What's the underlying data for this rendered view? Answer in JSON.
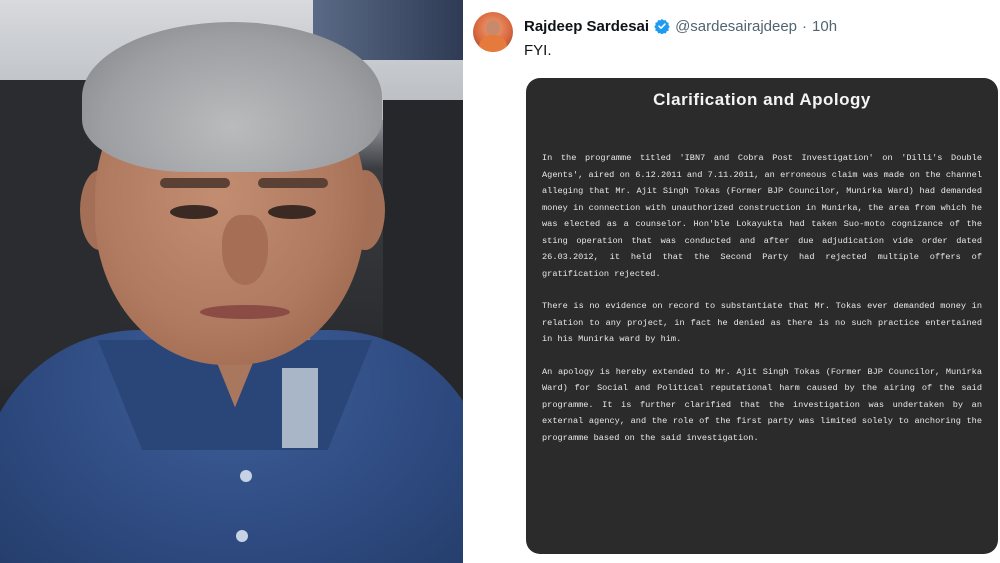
{
  "tweet": {
    "display_name": "Rajdeep Sardesai",
    "handle": "@sardesairajdeep",
    "separator": "·",
    "time": "10h",
    "text": "FYI.",
    "verified_color": "#1d9bf0"
  },
  "notice": {
    "title": "Clarification and Apology",
    "paragraphs": [
      "In the programme titled 'IBN7 and Cobra Post Investigation' on 'Dilli's Double Agents', aired on 6.12.2011 and 7.11.2011, an erroneous claim was made on the channel alleging that Mr. Ajit Singh Tokas (Former BJP Councilor, Munirka Ward) had demanded money in connection with unauthorized construction in Munirka, the area from which he was elected as a counselor. Hon'ble Lokayukta had taken Suo-moto cognizance of the sting operation that was conducted and after due adjudication vide order dated 26.03.2012, it held that the Second Party had rejected multiple offers of gratification rejected.",
      "There is no evidence on record to substantiate that Mr. Tokas ever demanded money in relation to any project, in fact he denied as there is no such practice entertained in his Munirka ward by him.",
      "An apology is hereby extended to Mr. Ajit Singh Tokas (Former BJP Councilor, Munirka Ward) for Social and Political reputational harm caused by the airing of the said programme. It is further clarified that the investigation was undertaken by an external agency, and the role of the first party was limited solely to anchoring the programme based on the said investigation."
    ]
  }
}
